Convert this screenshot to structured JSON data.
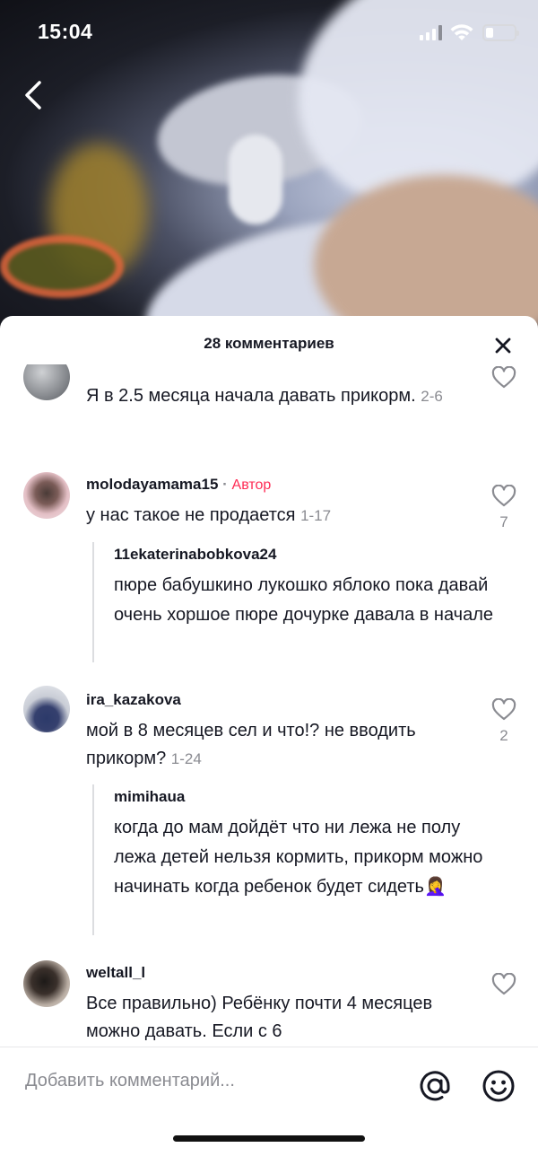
{
  "status_bar": {
    "time": "15:04"
  },
  "sheet": {
    "title": "28 комментариев"
  },
  "comments": [
    {
      "text": "Я в 2.5 месяца начала давать прикорм.",
      "date": "2-6"
    },
    {
      "username": "molodayamama15",
      "separator": "·",
      "author_label": "Автор",
      "text": "у нас такое не продается",
      "date": "1-17",
      "likes": "7",
      "reply": {
        "username": "11ekaterinabobkova24",
        "text": "пюре бабушкино лукошко яблоко пока давай очень хоршое пюре дочурке давала в начале"
      }
    },
    {
      "username": "ira_kazakova",
      "text": "мой в 8 месяцев сел и что!? не вводить прикорм?",
      "date": "1-24",
      "likes": "2",
      "reply": {
        "username": "mimihaua",
        "text": "когда до мам дойдёт что ни лежа не полу лежа детей нельзя кормить, прикорм можно начинать когда ребенок будет сидеть🤦‍♀️"
      }
    },
    {
      "username": "weltall_l",
      "text": "Все правильно) Ребёнку почти 4 месяцев можно давать. Если с 6"
    }
  ],
  "input": {
    "placeholder": "Добавить комментарий..."
  },
  "colors": {
    "accent": "#fe2c55",
    "muted": "#8a8b91",
    "text": "#161823"
  }
}
